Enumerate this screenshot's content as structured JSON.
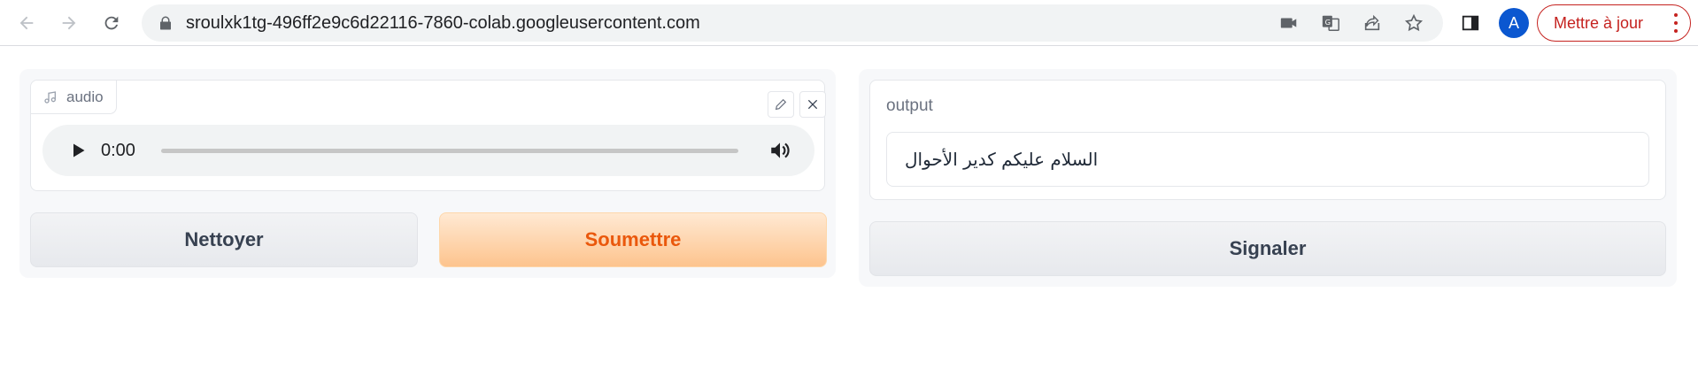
{
  "browser": {
    "url": "sroulxk1tg-496ff2e9c6d22116-7860-colab.googleusercontent.com",
    "avatar_letter": "A",
    "update_label": "Mettre à jour",
    "icons": [
      "back-icon",
      "forward-icon",
      "reload-icon",
      "lock-icon",
      "camera-icon",
      "translate-icon",
      "share-icon",
      "star-icon",
      "side-panel-icon",
      "more-icon"
    ]
  },
  "input": {
    "audio_label": "audio",
    "time": "0:00",
    "clear_label": "Nettoyer",
    "submit_label": "Soumettre"
  },
  "output": {
    "label": "output",
    "value": "السلام عليكم كدير الأحوال",
    "flag_label": "Signaler"
  },
  "colors": {
    "primary_text": "#ea580c",
    "update_red": "#c5221f",
    "avatar_blue": "#0b57d0"
  }
}
